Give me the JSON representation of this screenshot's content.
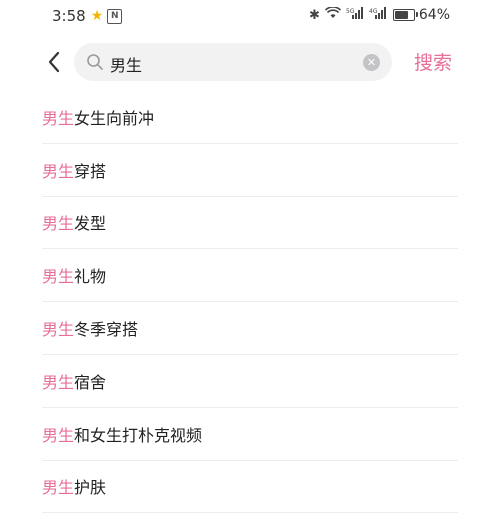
{
  "status_bar": {
    "time": "3:58",
    "network": "5G",
    "network2": "4G",
    "battery": "64%",
    "battery_level": 0.64
  },
  "search": {
    "query": "男生",
    "button_label": "搜索"
  },
  "suggestions": [
    {
      "highlight": "男生",
      "rest": "女生向前冲"
    },
    {
      "highlight": "男生",
      "rest": "穿搭"
    },
    {
      "highlight": "男生",
      "rest": "发型"
    },
    {
      "highlight": "男生",
      "rest": "礼物"
    },
    {
      "highlight": "男生",
      "rest": "冬季穿搭"
    },
    {
      "highlight": "男生",
      "rest": "宿舍"
    },
    {
      "highlight": "男生",
      "rest": "和女生打朴克视频"
    },
    {
      "highlight": "男生",
      "rest": "护肤"
    }
  ],
  "colors": {
    "accent": "#e76f97",
    "search_bg": "#f2f2f3"
  }
}
